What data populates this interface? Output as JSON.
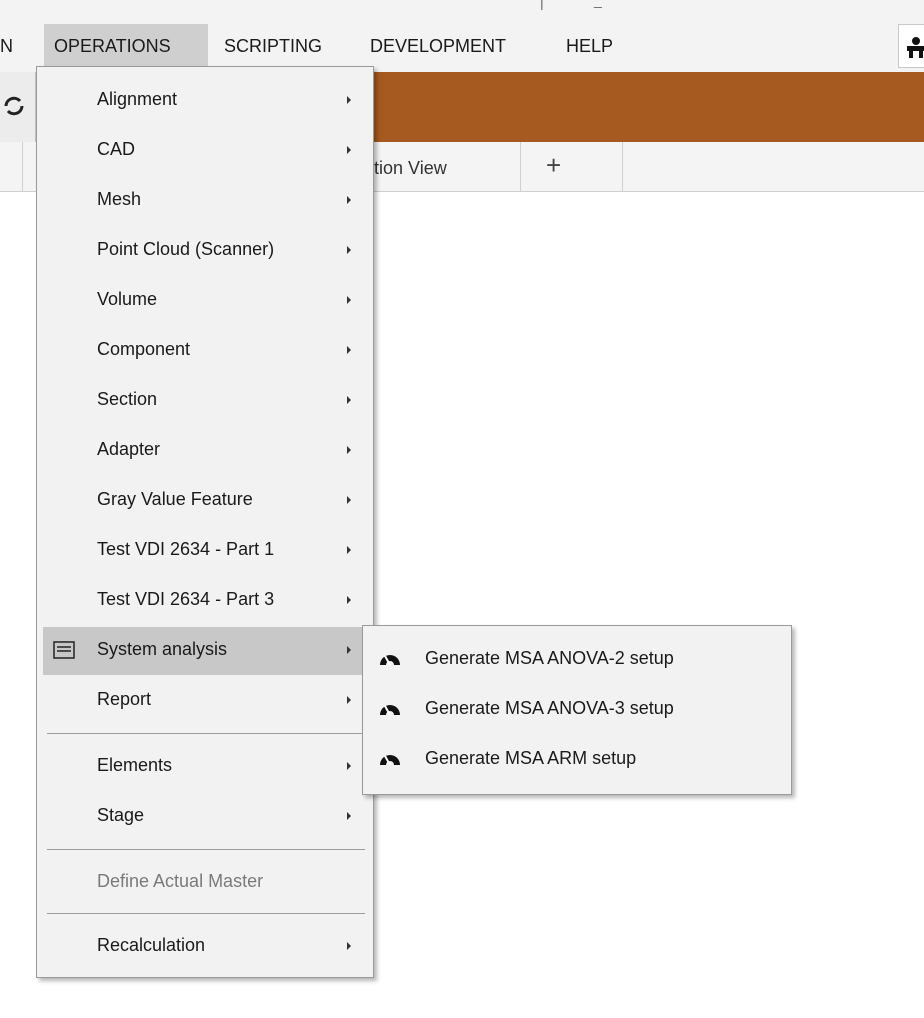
{
  "menubar": {
    "items": [
      {
        "label": "N"
      },
      {
        "label": "OPERATIONS"
      },
      {
        "label": "SCRIPTING"
      },
      {
        "label": "DEVELOPMENT"
      },
      {
        "label": "HELP"
      }
    ],
    "active": "OPERATIONS",
    "user_icon": "user-icon"
  },
  "title_fragment": {
    "left": "|",
    "right": "_"
  },
  "ribbon": {
    "color": "#a65a1f",
    "left_icon": "refresh-icon"
  },
  "tabs": {
    "items": [
      {
        "label": "tion View"
      }
    ],
    "add_label": "+"
  },
  "operations_menu": {
    "items": [
      {
        "label": "Alignment",
        "submenu": true
      },
      {
        "label": "CAD",
        "submenu": true
      },
      {
        "label": "Mesh",
        "submenu": true
      },
      {
        "label": "Point Cloud (Scanner)",
        "submenu": true
      },
      {
        "label": "Volume",
        "submenu": true
      },
      {
        "label": "Component",
        "submenu": true
      },
      {
        "label": "Section",
        "submenu": true
      },
      {
        "label": "Adapter",
        "submenu": true
      },
      {
        "label": "Gray Value Feature",
        "submenu": true
      },
      {
        "label": "Test VDI 2634 - Part 1",
        "submenu": true
      },
      {
        "label": "Test VDI 2634 - Part 3",
        "submenu": true
      },
      {
        "label": "System analysis",
        "submenu": true,
        "icon": "window-icon",
        "highlighted": true
      },
      {
        "label": "Report",
        "submenu": true
      },
      {
        "label": "Elements",
        "submenu": true
      },
      {
        "label": "Stage",
        "submenu": true
      },
      {
        "label": "Define Actual Master",
        "submenu": false,
        "disabled": true
      },
      {
        "label": "Recalculation",
        "submenu": true
      }
    ]
  },
  "system_analysis_submenu": {
    "items": [
      {
        "label": "Generate MSA ANOVA-2 setup",
        "icon": "gauge-icon"
      },
      {
        "label": "Generate MSA ANOVA-3 setup",
        "icon": "gauge-icon"
      },
      {
        "label": "Generate MSA ARM setup",
        "icon": "gauge-icon"
      }
    ]
  }
}
